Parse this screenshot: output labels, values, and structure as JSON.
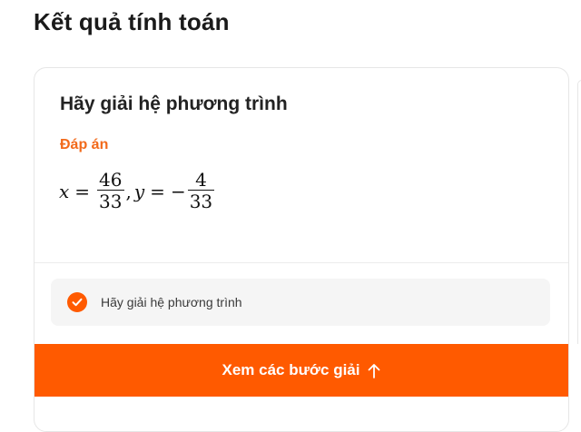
{
  "page_title": "Kết quả tính toán",
  "card": {
    "problem_title": "Hãy giải hệ phương trình",
    "answer_label": "Đáp án",
    "answer": {
      "x_var": "x",
      "eq": "=",
      "x_num": "46",
      "x_den": "33",
      "comma": ",",
      "y_var": "y",
      "minus": "−",
      "y_num": "4",
      "y_den": "33"
    },
    "step_text": "Hãy giải hệ phương trình",
    "step_icon": "check-circle-icon",
    "cta_label": "Xem các bước giải",
    "cta_icon": "arrow-up-icon"
  },
  "colors": {
    "accent": "#FF5A00",
    "answer_label": "#F26A1B",
    "pill_bg": "#F5F5F5"
  }
}
